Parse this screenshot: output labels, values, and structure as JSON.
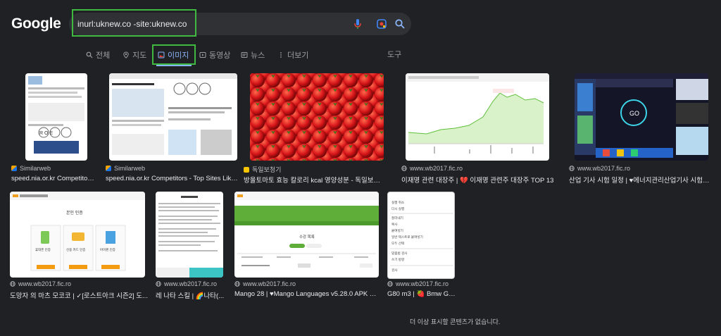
{
  "header": {
    "logo": "Google",
    "query": "inurl:uknew.co -site:uknew.co"
  },
  "tabs": [
    {
      "label": "전체"
    },
    {
      "label": "지도"
    },
    {
      "label": "이미지"
    },
    {
      "label": "동영상"
    },
    {
      "label": "뉴스"
    },
    {
      "label": "더보기"
    }
  ],
  "tools_label": "도구",
  "results": [
    {
      "source": "Similarweb",
      "title": "speed.nia.or.kr Competitors ..."
    },
    {
      "source": "Similarweb",
      "title": "speed.nia.or.kr Competitors - Top Sites Like s..."
    },
    {
      "source": "독일보청기",
      "title": "방울토마토 효능 칼로리 kcal 영양성분 - 독일보청기"
    },
    {
      "source": "www.wb2017.fic.ro",
      "title": "이재명 관련 대장주 | 💔 이재명 관련주 대장주 TOP 13"
    },
    {
      "source": "www.wb2017.fic.ro",
      "title": "산업 기사 시험 일정 | ♥에너지관리산업기사 시험일정 ..."
    },
    {
      "source": "www.wb2017.fic.ro",
      "title": "도망자 의 마츠 모코코 | ✓[로스트아크 시즌2] 도..."
    },
    {
      "source": "www.wb2017.fic.ro",
      "title": "레 나타 스킬 | 🌈나타(..."
    },
    {
      "source": "www.wb2017.fic.ro",
      "title": "Mango 28 | ♥Mango Languages v5.28.0 APK + MO..."
    },
    {
      "source": "www.wb2017.fic.ro",
      "title": "G80 m3 | 🍓 Bmw G80 ..."
    }
  ],
  "thumb_text": {
    "roe": "R O E",
    "go": "GO",
    "verify_title": "본인 인증",
    "verify_opt1": "휴대폰 인증",
    "verify_opt2": "신용 카드 인증",
    "verify_opt3": "아이핀 인증",
    "mango_title": "수강 목록",
    "menu_items": [
      "실행 취소",
      "다시 실행",
      "잘라내기",
      "복사",
      "붙여넣기",
      "일반 텍스트로 붙여넣기",
      "모두 선택",
      "맞춤법 검사",
      "쓰기 방향",
      "검사"
    ]
  },
  "footer": "더 이상 표시할 콘텐츠가 없습니다.",
  "colors": {
    "background": "#202124",
    "accent": "#8ab4f8",
    "highlight": "#3fb93f"
  }
}
